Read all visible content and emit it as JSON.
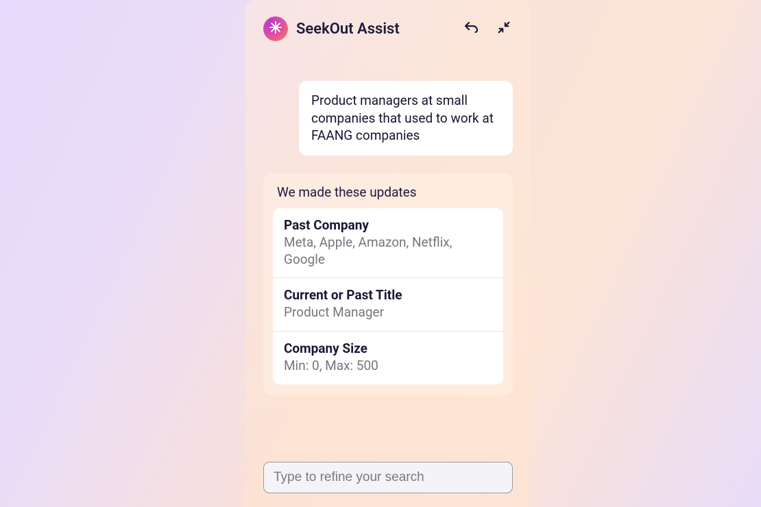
{
  "header": {
    "title": "SeekOut Assist"
  },
  "conversation": {
    "user_message": "Product managers at small companies that used to work at FAANG companies",
    "assistant_heading": "We made these updates",
    "updates": [
      {
        "title": "Past Company",
        "value": "Meta, Apple, Amazon, Netflix, Google"
      },
      {
        "title": "Current or Past Title",
        "value": "Product Manager"
      },
      {
        "title": "Company Size",
        "value": "Min: 0, Max: 500"
      }
    ]
  },
  "input": {
    "placeholder": "Type to refine your search"
  }
}
